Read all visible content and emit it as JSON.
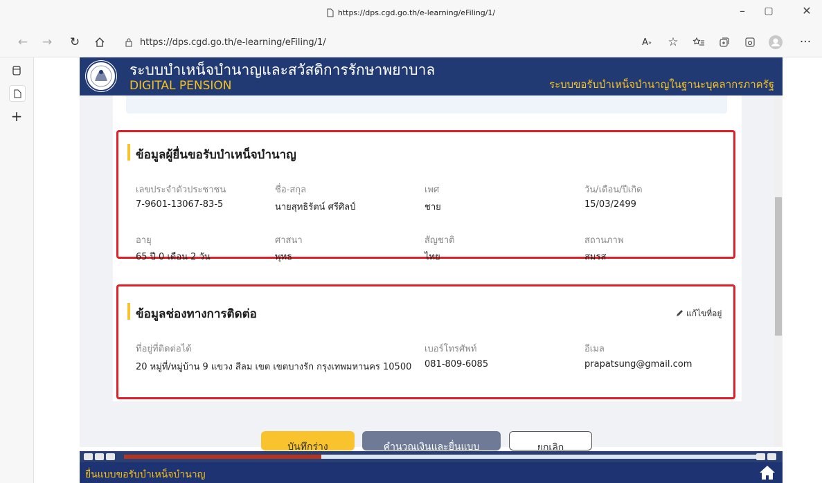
{
  "browser": {
    "title_url": "https://dps.cgd.go.th/e-learning/eFiling/1/",
    "address": "https://dps.cgd.go.th/e-learning/eFiling/1/"
  },
  "header": {
    "title": "ระบบบำเหน็จบำนาญและสวัสดิการรักษาพยาบาล",
    "subtitle": "DIGITAL PENSION",
    "right": "ระบบขอรับบำเหน็จบำนาญในฐานะบุคลากรภาครัฐ"
  },
  "applicant": {
    "title": "ข้อมูลผู้ยื่นขอรับบำเหน็จบำนาญ",
    "fields": [
      {
        "label": "เลขประจำตัวประชาชน",
        "value": "7-9601-13067-83-5"
      },
      {
        "label": "ชื่อ-สกุล",
        "value": "นายสุทธิรัตน์ ศรีศิลป์"
      },
      {
        "label": "เพศ",
        "value": "ชาย"
      },
      {
        "label": "วัน/เดือน/ปีเกิด",
        "value": "15/03/2499"
      },
      {
        "label": "อายุ",
        "value": "65 ปี 0 เดือน 2 วัน"
      },
      {
        "label": "ศาสนา",
        "value": "พุทธ"
      },
      {
        "label": "สัญชาติ",
        "value": "ไทย"
      },
      {
        "label": "สถานภาพ",
        "value": "สมรส"
      }
    ]
  },
  "contact": {
    "title": "ข้อมูลช่องทางการติดต่อ",
    "edit_label": "แก้ไขที่อยู่",
    "fields": [
      {
        "label": "ที่อยู่ที่ติดต่อได้",
        "value": "20 หมู่ที่/หมู่บ้าน 9 แขวง สีลม เขต เขตบางรัก กรุงเทพมหานคร 10500"
      },
      {
        "label": "เบอร์โทรศัพท์",
        "value": "081-809-6085"
      },
      {
        "label": "อีเมล",
        "value": "prapatsung@gmail.com"
      }
    ]
  },
  "actions": {
    "save_draft": "บันทึกร่าง",
    "calculate_submit": "คำนวณเงินและยื่นแบบ",
    "cancel": "ยกเลิก"
  },
  "player": {
    "progress": 0.31
  },
  "footer": {
    "title": "ยื่นแบบขอรับบำเหน็จบำนาญ"
  },
  "colors": {
    "header_bg": "#223a73",
    "accent_yellow": "#f6c21b",
    "highlight_red": "#e01f26",
    "save_button": "#f8c32c",
    "submit_button": "#6e7a96"
  }
}
